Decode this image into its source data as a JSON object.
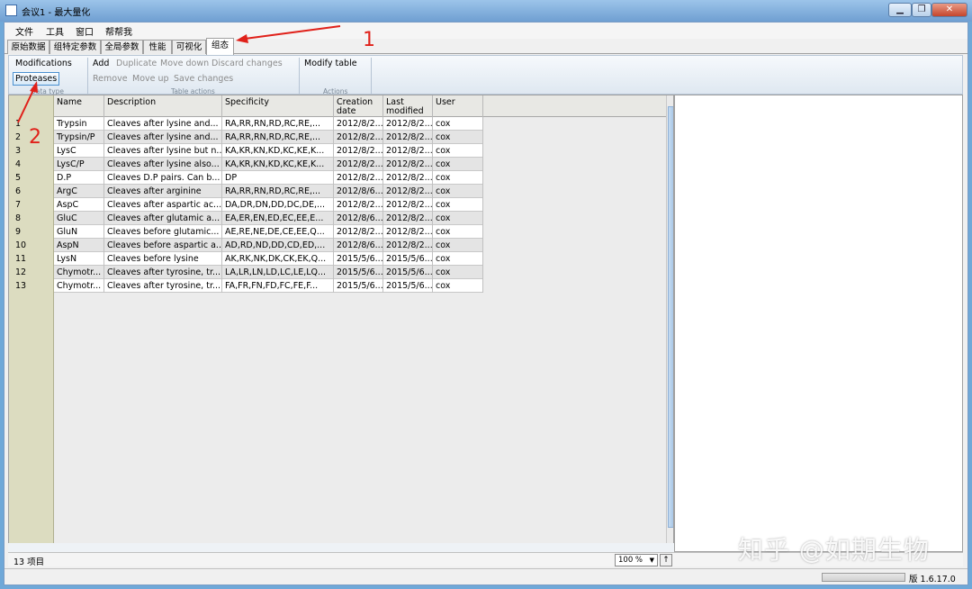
{
  "window": {
    "title": "会议1 - 最大量化"
  },
  "menu": [
    "文件",
    "工具",
    "窗口",
    "帮帮我"
  ],
  "tabs": [
    "原始数据",
    "组特定参数",
    "全局参数",
    "性能",
    "可视化",
    "组态"
  ],
  "ribbon": {
    "data_type": {
      "modifications": "Modifications",
      "proteases": "Proteases",
      "caption": "Data type"
    },
    "table_actions": {
      "add": "Add",
      "duplicate": "Duplicate",
      "move_down": "Move down",
      "discard": "Discard changes",
      "remove": "Remove",
      "move_up": "Move up",
      "save": "Save changes",
      "caption": "Table actions"
    },
    "actions": {
      "modify_table": "Modify table",
      "caption": "Actions"
    }
  },
  "table": {
    "columns": [
      "Name",
      "Description",
      "Specificity",
      "Creation\ndate",
      "Last\nmodified",
      "User"
    ],
    "rows": [
      {
        "n": "1",
        "name": "Trypsin",
        "desc": "Cleaves after lysine and...",
        "spec": "RA,RR,RN,RD,RC,RE,...",
        "created": "2012/8/2...",
        "modified": "2012/8/2...",
        "user": "cox"
      },
      {
        "n": "2",
        "name": "Trypsin/P",
        "desc": "Cleaves after lysine and...",
        "spec": "RA,RR,RN,RD,RC,RE,...",
        "created": "2012/8/2...",
        "modified": "2012/8/2...",
        "user": "cox"
      },
      {
        "n": "3",
        "name": "LysC",
        "desc": "Cleaves after lysine but n...",
        "spec": "KA,KR,KN,KD,KC,KE,K...",
        "created": "2012/8/2...",
        "modified": "2012/8/2...",
        "user": "cox"
      },
      {
        "n": "4",
        "name": "LysC/P",
        "desc": "Cleaves after lysine also...",
        "spec": "KA,KR,KN,KD,KC,KE,K...",
        "created": "2012/8/2...",
        "modified": "2012/8/2...",
        "user": "cox"
      },
      {
        "n": "5",
        "name": "D.P",
        "desc": "Cleaves D.P pairs. Can b...",
        "spec": "DP",
        "created": "2012/8/2...",
        "modified": "2012/8/2...",
        "user": "cox"
      },
      {
        "n": "6",
        "name": "ArgC",
        "desc": "Cleaves after arginine",
        "spec": "RA,RR,RN,RD,RC,RE,...",
        "created": "2012/8/6...",
        "modified": "2012/8/2...",
        "user": "cox"
      },
      {
        "n": "7",
        "name": "AspC",
        "desc": "Cleaves after aspartic ac...",
        "spec": "DA,DR,DN,DD,DC,DE,...",
        "created": "2012/8/2...",
        "modified": "2012/8/2...",
        "user": "cox"
      },
      {
        "n": "8",
        "name": "GluC",
        "desc": "Cleaves after glutamic a...",
        "spec": "EA,ER,EN,ED,EC,EE,E...",
        "created": "2012/8/6...",
        "modified": "2012/8/2...",
        "user": "cox"
      },
      {
        "n": "9",
        "name": "GluN",
        "desc": "Cleaves before glutamic...",
        "spec": "AE,RE,NE,DE,CE,EE,Q...",
        "created": "2012/8/2...",
        "modified": "2012/8/2...",
        "user": "cox"
      },
      {
        "n": "10",
        "name": "AspN",
        "desc": "Cleaves before aspartic a...",
        "spec": "AD,RD,ND,DD,CD,ED,...",
        "created": "2012/8/6...",
        "modified": "2012/8/2...",
        "user": "cox"
      },
      {
        "n": "11",
        "name": "LysN",
        "desc": "Cleaves before lysine",
        "spec": "AK,RK,NK,DK,CK,EK,Q...",
        "created": "2015/5/6...",
        "modified": "2015/5/6...",
        "user": "cox"
      },
      {
        "n": "12",
        "name": "Chymotr...",
        "desc": "Cleaves after tyrosine, tr...",
        "spec": "LA,LR,LN,LD,LC,LE,LQ...",
        "created": "2015/5/6...",
        "modified": "2015/5/6...",
        "user": "cox"
      },
      {
        "n": "13",
        "name": "Chymotr...",
        "desc": "Cleaves after tyrosine, tr...",
        "spec": "FA,FR,FN,FD,FC,FE,F...",
        "created": "2015/5/6...",
        "modified": "2015/5/6...",
        "user": "cox"
      }
    ]
  },
  "status": {
    "items": "13 项目",
    "zoom": "100 %",
    "up_arrow": "↑",
    "version": "版 1.6.17.0"
  },
  "annotations": {
    "one": "1",
    "two": "2"
  },
  "watermark": "知乎 @如期生物",
  "colors": {
    "annotation_red": "#e0211a",
    "row_alt": "#e4e4e4",
    "row_header": "#dcdcc0"
  }
}
